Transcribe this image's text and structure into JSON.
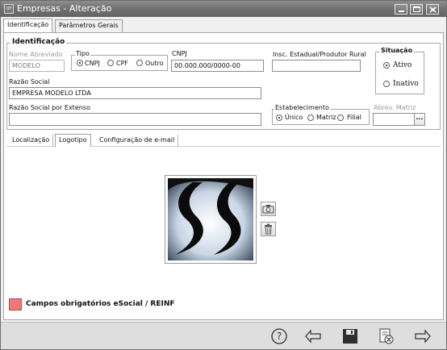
{
  "window": {
    "app_icon_text": "UF",
    "title": "Empresas - Alteração"
  },
  "tabs": [
    "Identificação",
    "Parâmetros Gerais"
  ],
  "identificacao": {
    "legend": "Identificação",
    "nome_abreviado": {
      "label": "Nome Abreviado",
      "value": "MODELO"
    },
    "tipo": {
      "label": "Tipo",
      "options": [
        "CNPJ",
        "CPF",
        "Outro"
      ],
      "selected": "CNPJ"
    },
    "cnpj": {
      "label": "CNPJ",
      "value": "00.000.000/0000-00"
    },
    "insc_estadual": {
      "label": "Insc. Estadual/Produtor Rural",
      "value": ""
    },
    "razao_social": {
      "label": "Razão Social",
      "value": "EMPRESA MODELO LTDA"
    },
    "razao_social_extenso": {
      "label": "Razão Social por Extenso",
      "value": ""
    },
    "estabelecimento": {
      "label": "Estabelecimento",
      "options": [
        "Único",
        "Matriz",
        "Filial"
      ],
      "selected": "Único"
    },
    "abrev_matriz": {
      "label": "Abrev. Matriz",
      "value": "",
      "button": "..."
    },
    "situacao": {
      "legend": "Situação",
      "options": [
        "Ativo",
        "Inativo"
      ],
      "selected": "Ativo"
    }
  },
  "subtabs": [
    "Localização",
    "Logotipo",
    "Configuração de e-mail"
  ],
  "logo_actions": {
    "camera": "camera-icon",
    "trash": "trash-icon"
  },
  "legend_note": {
    "color": "#f07878",
    "text": "Campos obrigatórios eSocial / REINF"
  },
  "footer_buttons": [
    "help-icon",
    "back-arrow-icon",
    "save-icon",
    "cancel-icon",
    "forward-arrow-icon"
  ]
}
